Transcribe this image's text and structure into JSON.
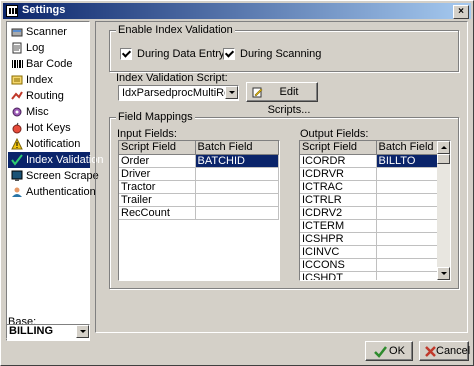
{
  "window": {
    "title": "Settings",
    "close_glyph": "×"
  },
  "sidebar": {
    "items": [
      {
        "label": "Scanner",
        "icon": "scanner-icon"
      },
      {
        "label": "Log",
        "icon": "log-icon"
      },
      {
        "label": "Bar Code",
        "icon": "barcode-icon"
      },
      {
        "label": "Index",
        "icon": "index-icon"
      },
      {
        "label": "Routing",
        "icon": "routing-icon"
      },
      {
        "label": "Misc",
        "icon": "misc-icon"
      },
      {
        "label": "Hot Keys",
        "icon": "hotkeys-icon"
      },
      {
        "label": "Notification",
        "icon": "notification-icon"
      },
      {
        "label": "Index Validation",
        "icon": "checkmark-icon",
        "selected": true
      },
      {
        "label": "Screen Scrape",
        "icon": "screen-scrape-icon"
      },
      {
        "label": "Authentication",
        "icon": "authentication-icon"
      }
    ],
    "base_label": "Base:",
    "base_value": "BILLING"
  },
  "index_validation": {
    "group_title": "Enable Index Validation",
    "during_data_entry": {
      "label": "During Data Entry",
      "checked": true
    },
    "during_scanning": {
      "label": "During Scanning",
      "checked": true
    }
  },
  "script": {
    "label": "Index Validation Script:",
    "value": "IdxParsedprocMultiRow",
    "edit_button": "Edit Scripts..."
  },
  "field_mappings": {
    "group_title": "Field Mappings",
    "input": {
      "label": "Input Fields:",
      "columns": [
        "Script Field",
        "Batch Field"
      ],
      "rows": [
        [
          "Order",
          "BATCHID"
        ],
        [
          "Driver",
          ""
        ],
        [
          "Tractor",
          ""
        ],
        [
          "Trailer",
          ""
        ],
        [
          "RecCount",
          ""
        ]
      ]
    },
    "output": {
      "label": "Output Fields:",
      "columns": [
        "Script Field",
        "Batch Field"
      ],
      "rows": [
        [
          "ICORDR",
          "BILLTO"
        ],
        [
          "ICDRVR",
          ""
        ],
        [
          "ICTRAC",
          ""
        ],
        [
          "ICTRLR",
          ""
        ],
        [
          "ICDRV2",
          ""
        ],
        [
          "ICTERM",
          ""
        ],
        [
          "ICSHPR",
          ""
        ],
        [
          "ICINVC",
          ""
        ],
        [
          "ICCONS",
          ""
        ],
        [
          "ICSHDT",
          ""
        ]
      ]
    }
  },
  "footer": {
    "ok": "OK",
    "cancel": "Cancel"
  },
  "colors": {
    "selection": "#0a246a",
    "face": "#d4d0c8",
    "ok_check": "#2e8b2e",
    "cancel_x": "#c0392b"
  }
}
